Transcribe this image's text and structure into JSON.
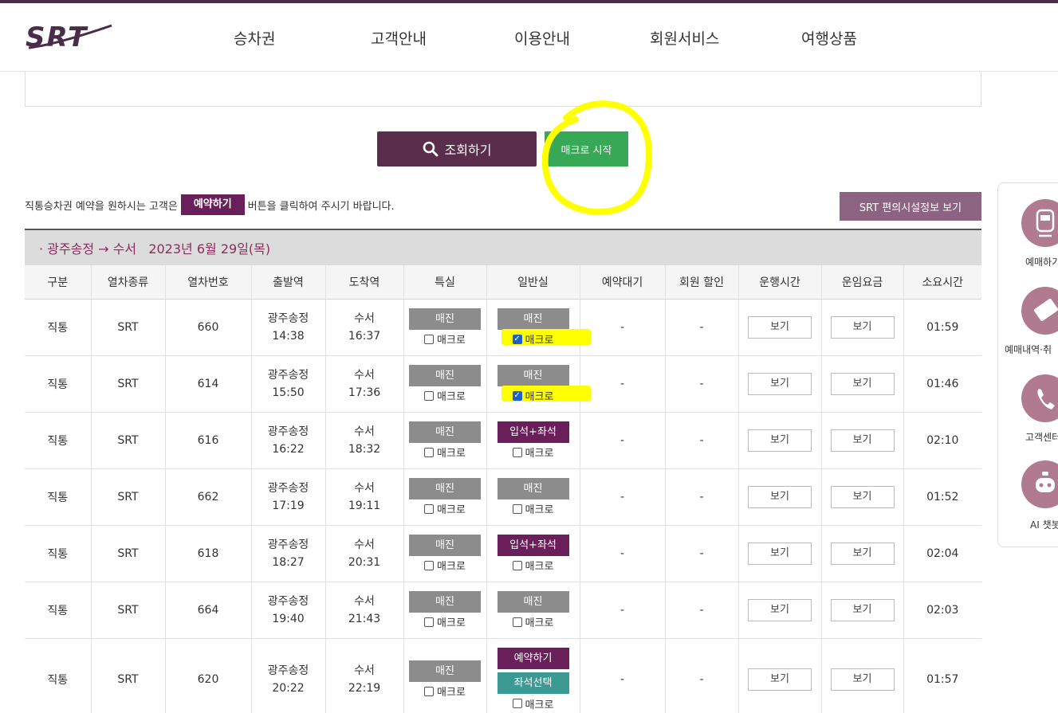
{
  "header": {
    "logo": "SRT",
    "nav": [
      "승차권",
      "고객안내",
      "이용안내",
      "회원서비스",
      "여행상품"
    ]
  },
  "buttons": {
    "search": "조회하기",
    "macro": "매크로 시작",
    "facility": "SRT 편의시설정보 보기"
  },
  "notice": {
    "before": "직통승차권 예약을 원하시는 고객은",
    "pill": "예약하기",
    "after": "버튼을 클릭하여 주시기 바랍니다."
  },
  "route": "· 광주송정 → 수서   2023년 6월 29일(목)",
  "table": {
    "headers": [
      "구분",
      "열차종류",
      "열차번호",
      "출발역",
      "도착역",
      "특실",
      "일반실",
      "예약대기",
      "회원 할인",
      "운행시간",
      "운임요금",
      "소요시간"
    ],
    "macro_label": "매크로",
    "view_label": "보기",
    "rows": [
      {
        "type": "직통",
        "kind": "SRT",
        "no": "660",
        "dep_st": "광주송정",
        "dep_t": "14:38",
        "arr_st": "수서",
        "arr_t": "16:37",
        "special": "매진",
        "general": [
          "매진"
        ],
        "general_macro_checked": true,
        "wait": "-",
        "discount": "-",
        "duration": "01:59"
      },
      {
        "type": "직통",
        "kind": "SRT",
        "no": "614",
        "dep_st": "광주송정",
        "dep_t": "15:50",
        "arr_st": "수서",
        "arr_t": "17:36",
        "special": "매진",
        "general": [
          "매진"
        ],
        "general_macro_checked": true,
        "wait": "-",
        "discount": "-",
        "duration": "01:46"
      },
      {
        "type": "직통",
        "kind": "SRT",
        "no": "616",
        "dep_st": "광주송정",
        "dep_t": "16:22",
        "arr_st": "수서",
        "arr_t": "18:32",
        "special": "매진",
        "general": [
          "입석+좌석"
        ],
        "general_macro_checked": false,
        "wait": "-",
        "discount": "-",
        "duration": "02:10"
      },
      {
        "type": "직통",
        "kind": "SRT",
        "no": "662",
        "dep_st": "광주송정",
        "dep_t": "17:19",
        "arr_st": "수서",
        "arr_t": "19:11",
        "special": "매진",
        "general": [
          "매진"
        ],
        "general_macro_checked": false,
        "wait": "-",
        "discount": "-",
        "duration": "01:52"
      },
      {
        "type": "직통",
        "kind": "SRT",
        "no": "618",
        "dep_st": "광주송정",
        "dep_t": "18:27",
        "arr_st": "수서",
        "arr_t": "20:31",
        "special": "매진",
        "general": [
          "입석+좌석"
        ],
        "general_macro_checked": false,
        "wait": "-",
        "discount": "-",
        "duration": "02:04"
      },
      {
        "type": "직통",
        "kind": "SRT",
        "no": "664",
        "dep_st": "광주송정",
        "dep_t": "19:40",
        "arr_st": "수서",
        "arr_t": "21:43",
        "special": "매진",
        "general": [
          "매진"
        ],
        "general_macro_checked": false,
        "wait": "-",
        "discount": "-",
        "duration": "02:03"
      },
      {
        "type": "직통",
        "kind": "SRT",
        "no": "620",
        "dep_st": "광주송정",
        "dep_t": "20:22",
        "arr_st": "수서",
        "arr_t": "22:19",
        "special": "매진",
        "general": [
          "예약하기",
          "좌석선택"
        ],
        "general_macro_checked": false,
        "wait": "-",
        "discount": "-",
        "duration": "01:57"
      }
    ]
  },
  "quick_menu": [
    "예매하기",
    "예매내역·취",
    "고객센터",
    "AI 챗봇"
  ],
  "colors": {
    "brand": "#5a2d4d",
    "sold_out": "#8c8c8c",
    "available": "#6b1f5a",
    "seat_select": "#3c9a95",
    "macro_green": "#37a855",
    "annotation_yellow": "#ffff00"
  }
}
